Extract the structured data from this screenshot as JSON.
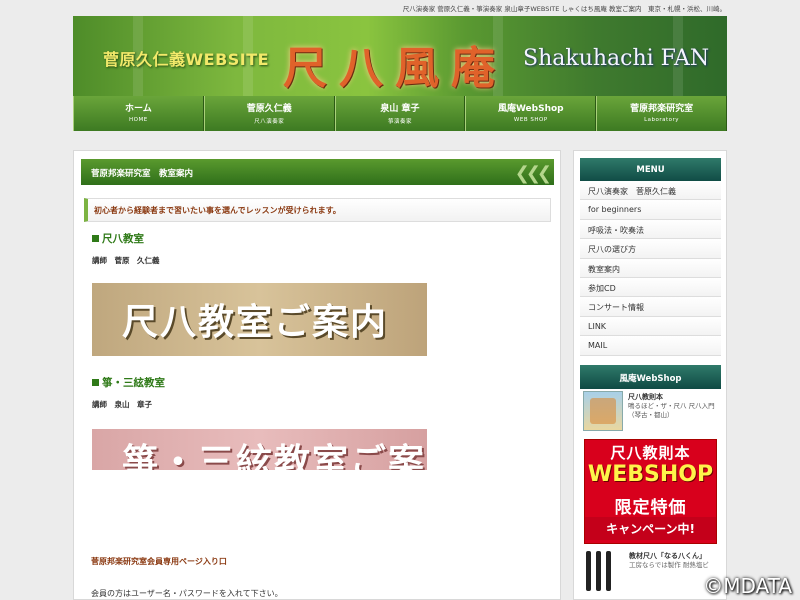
{
  "header": {
    "topline": "尺八演奏家 菅原久仁義・箏演奏家 泉山章子WEBSITE しゃくはち風庵 教室ご案内　東京・札幌・浜松、川崎。",
    "banner_left": "菅原久仁義WEBSITE",
    "banner_logo": "尺八風庵",
    "banner_right": "Shakuhachi FAN"
  },
  "nav": [
    {
      "label": "ホーム",
      "sub": "HOME"
    },
    {
      "label": "菅原久仁義",
      "sub": "尺八演奏家"
    },
    {
      "label": "泉山 章子",
      "sub": "箏演奏家"
    },
    {
      "label": "風庵WebShop",
      "sub": "WEB SHOP"
    },
    {
      "label": "菅原邦楽研究室",
      "sub": "Laboratory"
    }
  ],
  "main": {
    "section_title": "菅原邦楽研究室　教室案内",
    "notice": "初心者から経験者まで習いたい事を選んでレッスンが受けられます。",
    "class1": {
      "title": "尺八教室",
      "teacher": "講師　菅原　久仁義",
      "banner": "尺八教室ご案内"
    },
    "class2": {
      "title": "箏・三絃教室",
      "teacher": "講師　泉山　章子",
      "banner": "箏・三絃教室ご案内"
    },
    "member_title": "菅原邦楽研究室会員専用ページ入り口",
    "member_text": "会員の方はユーザー名・パスワードを入れて下さい。"
  },
  "sidebar": {
    "menu_title": "MENU",
    "menu_items": [
      "尺八演奏家　菅原久仁義",
      "for beginners",
      "呼吸法・吹奏法",
      "尺八の選び方",
      "教室案内",
      "参加CD",
      "コンサート情報",
      "LINK",
      "MAIL"
    ],
    "shop_title": "風庵WebShop",
    "shop_item_title": "尺八教則本",
    "shop_item_desc": "鳴るほど・ザ・尺八 尺八入門（琴古・都山）",
    "promo": {
      "line1": "尺八教則本",
      "line2": "WEBSHOP",
      "line3": "限定特価",
      "line4": "キャンペーン中!"
    },
    "flute_title": "教材尺八「なる八くん」",
    "flute_desc": "工房ならでは製作 耐熱塩ビ"
  },
  "copyright": "©MDATA"
}
